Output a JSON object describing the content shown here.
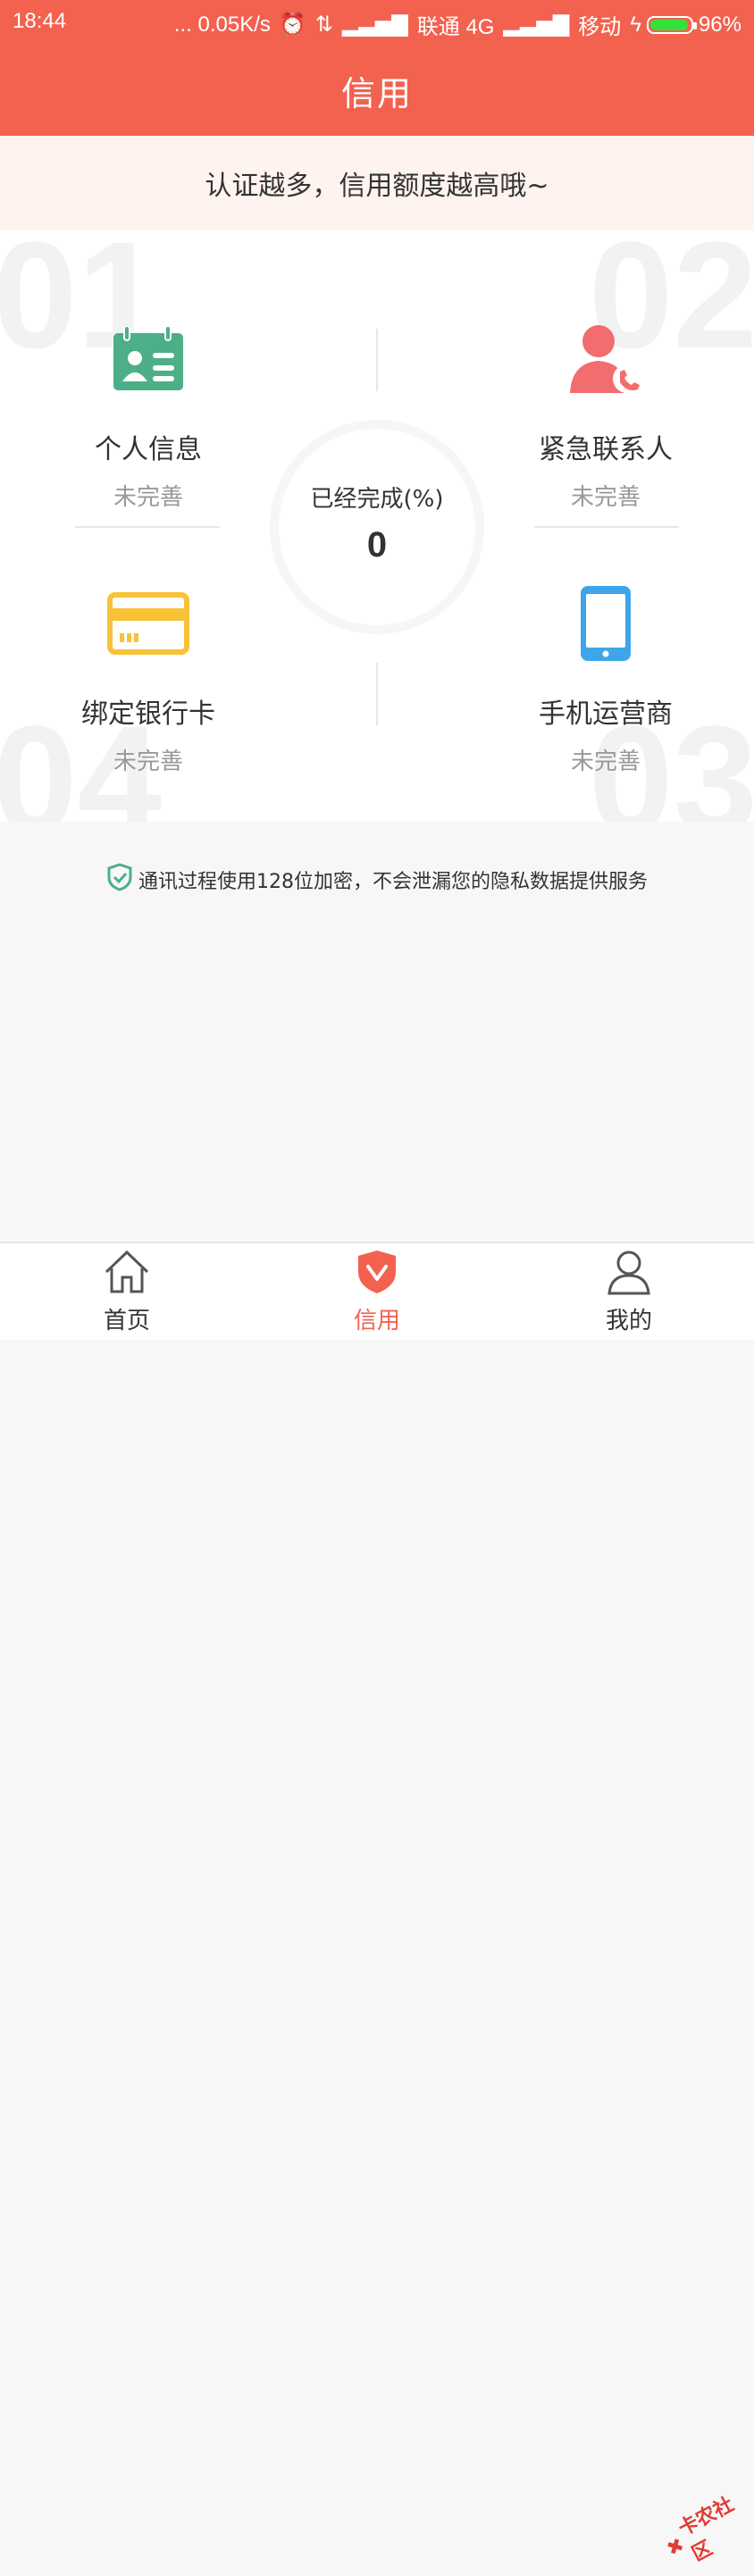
{
  "status_bar": {
    "time": "18:44",
    "right_text": "... 0.05K/s",
    "carrier1": "联通 4G",
    "carrier2": "移动",
    "battery": "96%"
  },
  "header": {
    "title": "信用"
  },
  "banner": {
    "text": "认证越多，信用额度越高哦~"
  },
  "cert_grid": {
    "bg_numbers": [
      "01",
      "02",
      "04",
      "03"
    ],
    "items": [
      {
        "title": "个人信息",
        "status": "未完善",
        "icon": "id-card-icon",
        "color": "#4caf88"
      },
      {
        "title": "紧急联系人",
        "status": "未完善",
        "icon": "contact-phone-icon",
        "color": "#f26d6d"
      },
      {
        "title": "绑定银行卡",
        "status": "未完善",
        "icon": "bank-card-icon",
        "color": "#f8c236"
      },
      {
        "title": "手机运营商",
        "status": "未完善",
        "icon": "mobile-phone-icon",
        "color": "#3ea6e8"
      }
    ],
    "progress": {
      "label": "已经完成(%)",
      "value": "0"
    }
  },
  "security_note": {
    "text": "通讯过程使用128位加密，不会泄漏您的隐私数据提供服务",
    "icon": "shield-check-icon",
    "color": "#4caf88"
  },
  "bottom_nav": {
    "items": [
      {
        "label": "首页",
        "icon": "home-icon"
      },
      {
        "label": "信用",
        "icon": "credit-shield-icon"
      },
      {
        "label": "我的",
        "icon": "user-icon"
      }
    ],
    "active_color": "#f2624f"
  },
  "watermark": {
    "text": "卡农社区"
  }
}
